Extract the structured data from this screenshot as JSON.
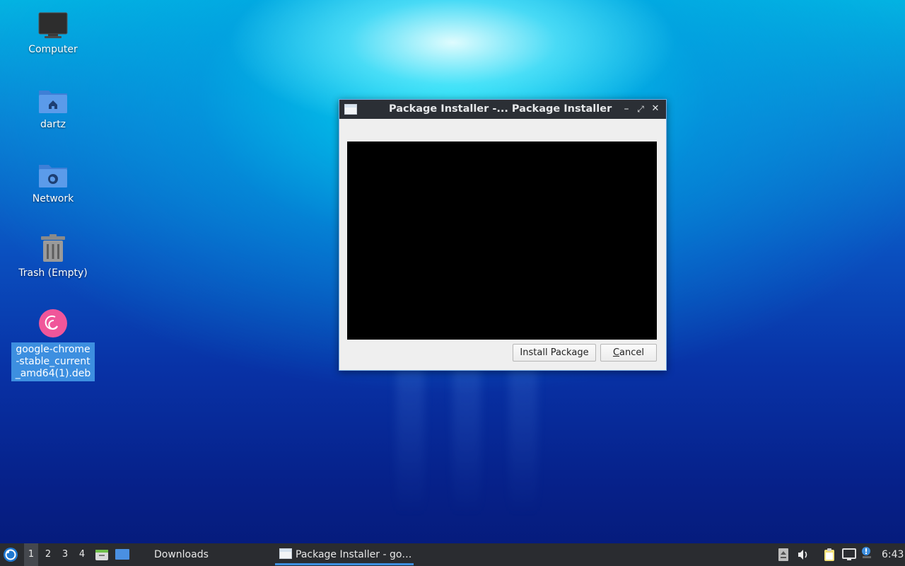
{
  "desktop": {
    "icons": [
      {
        "label": "Computer"
      },
      {
        "label": "dartz"
      },
      {
        "label": "Network"
      },
      {
        "label": "Trash (Empty)"
      },
      {
        "label": "google-chrome-stable_current_amd64(1).deb"
      }
    ]
  },
  "dialog": {
    "title": "Package Installer -...  Package Installer",
    "install_label": "Install Package",
    "cancel_mnemonic": "C",
    "cancel_rest": "ancel",
    "minimize_glyph": "–",
    "maximize_glyph": "⤢",
    "close_glyph": "✕"
  },
  "taskbar": {
    "workspaces": [
      "1",
      "2",
      "3",
      "4"
    ],
    "active_workspace": "1",
    "tasks": [
      {
        "label": "Downloads"
      },
      {
        "label": "Package Installer - go…"
      }
    ],
    "clock": "6:43"
  },
  "colors": {
    "accent": "#3d8fe0",
    "titlebar": "#2b2f35",
    "taskbar": "#2a2c30",
    "terminal": "#000000"
  }
}
